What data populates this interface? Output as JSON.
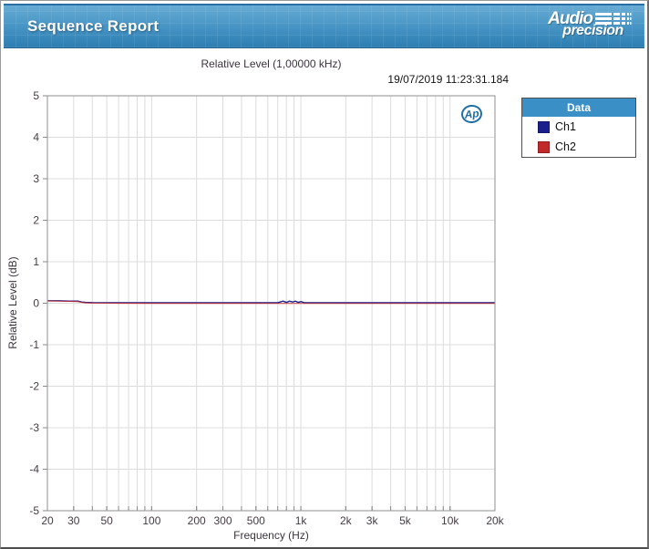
{
  "header": {
    "title": "Sequence Report",
    "logo": {
      "line1": "Audio",
      "line2": "precision"
    }
  },
  "report": {
    "timestamp": "19/07/2019 11:23:31.184",
    "ap_badge": "Ap"
  },
  "legend": {
    "header": "Data",
    "header_bg": "#3a8fc7",
    "items": [
      {
        "label": "Ch1",
        "color": "#1a1f8c"
      },
      {
        "label": "Ch2",
        "color": "#c22a2a"
      }
    ]
  },
  "chart_data": {
    "type": "line",
    "title": "Relative Level (1,00000 kHz)",
    "xlabel": "Frequency (Hz)",
    "ylabel": "Relative Level (dB)",
    "x_scale": "log",
    "xlim": [
      20,
      20000
    ],
    "ylim": [
      -5,
      5
    ],
    "grid": true,
    "legend_position": "right",
    "gridline_color": "#dcdcdc",
    "border_color": "#8f8f8f",
    "tick_label_color": "#453c43",
    "y_ticks": [
      {
        "v": -5,
        "t": "-5"
      },
      {
        "v": -4,
        "t": "-4"
      },
      {
        "v": -3,
        "t": "-3"
      },
      {
        "v": -2,
        "t": "-2"
      },
      {
        "v": -1,
        "t": "-1"
      },
      {
        "v": 0,
        "t": "0"
      },
      {
        "v": 1,
        "t": "1"
      },
      {
        "v": 2,
        "t": "2"
      },
      {
        "v": 3,
        "t": "3"
      },
      {
        "v": 4,
        "t": "4"
      },
      {
        "v": 5,
        "t": "5"
      }
    ],
    "x_ticks": [
      {
        "v": 20,
        "t": "20"
      },
      {
        "v": 30,
        "t": "30"
      },
      {
        "v": 50,
        "t": "50"
      },
      {
        "v": 100,
        "t": "100"
      },
      {
        "v": 200,
        "t": "200"
      },
      {
        "v": 300,
        "t": "300"
      },
      {
        "v": 500,
        "t": "500"
      },
      {
        "v": 1000,
        "t": "1k"
      },
      {
        "v": 2000,
        "t": "2k"
      },
      {
        "v": 3000,
        "t": "3k"
      },
      {
        "v": 5000,
        "t": "5k"
      },
      {
        "v": 10000,
        "t": "10k"
      },
      {
        "v": 20000,
        "t": "20k"
      }
    ],
    "series": [
      {
        "name": "Ch1",
        "color": "#1a1f8c",
        "points": [
          [
            20,
            0.06
          ],
          [
            24,
            0.06
          ],
          [
            28,
            0.05
          ],
          [
            32,
            0.05
          ],
          [
            34,
            0.03
          ],
          [
            36,
            0.02
          ],
          [
            40,
            0.015
          ],
          [
            60,
            0.012
          ],
          [
            100,
            0.012
          ],
          [
            200,
            0.012
          ],
          [
            400,
            0.012
          ],
          [
            700,
            0.012
          ],
          [
            760,
            0.05
          ],
          [
            800,
            0.02
          ],
          [
            840,
            0.05
          ],
          [
            880,
            0.03
          ],
          [
            920,
            0.05
          ],
          [
            960,
            0.02
          ],
          [
            1000,
            0.04
          ],
          [
            1050,
            0.015
          ],
          [
            2000,
            0.012
          ],
          [
            3000,
            0.012
          ],
          [
            5000,
            0.012
          ],
          [
            10000,
            0.012
          ],
          [
            20000,
            0.012
          ]
        ]
      },
      {
        "name": "Ch2",
        "color": "#c22a2a",
        "points": [
          [
            20,
            0.07
          ],
          [
            24,
            0.065
          ],
          [
            28,
            0.06
          ],
          [
            32,
            0.055
          ],
          [
            34,
            0.035
          ],
          [
            36,
            0.025
          ],
          [
            40,
            0.02
          ],
          [
            60,
            0.015
          ],
          [
            100,
            0.012
          ],
          [
            1000,
            0.01
          ],
          [
            5000,
            0.01
          ],
          [
            10000,
            0.01
          ],
          [
            20000,
            0.01
          ]
        ]
      }
    ]
  }
}
